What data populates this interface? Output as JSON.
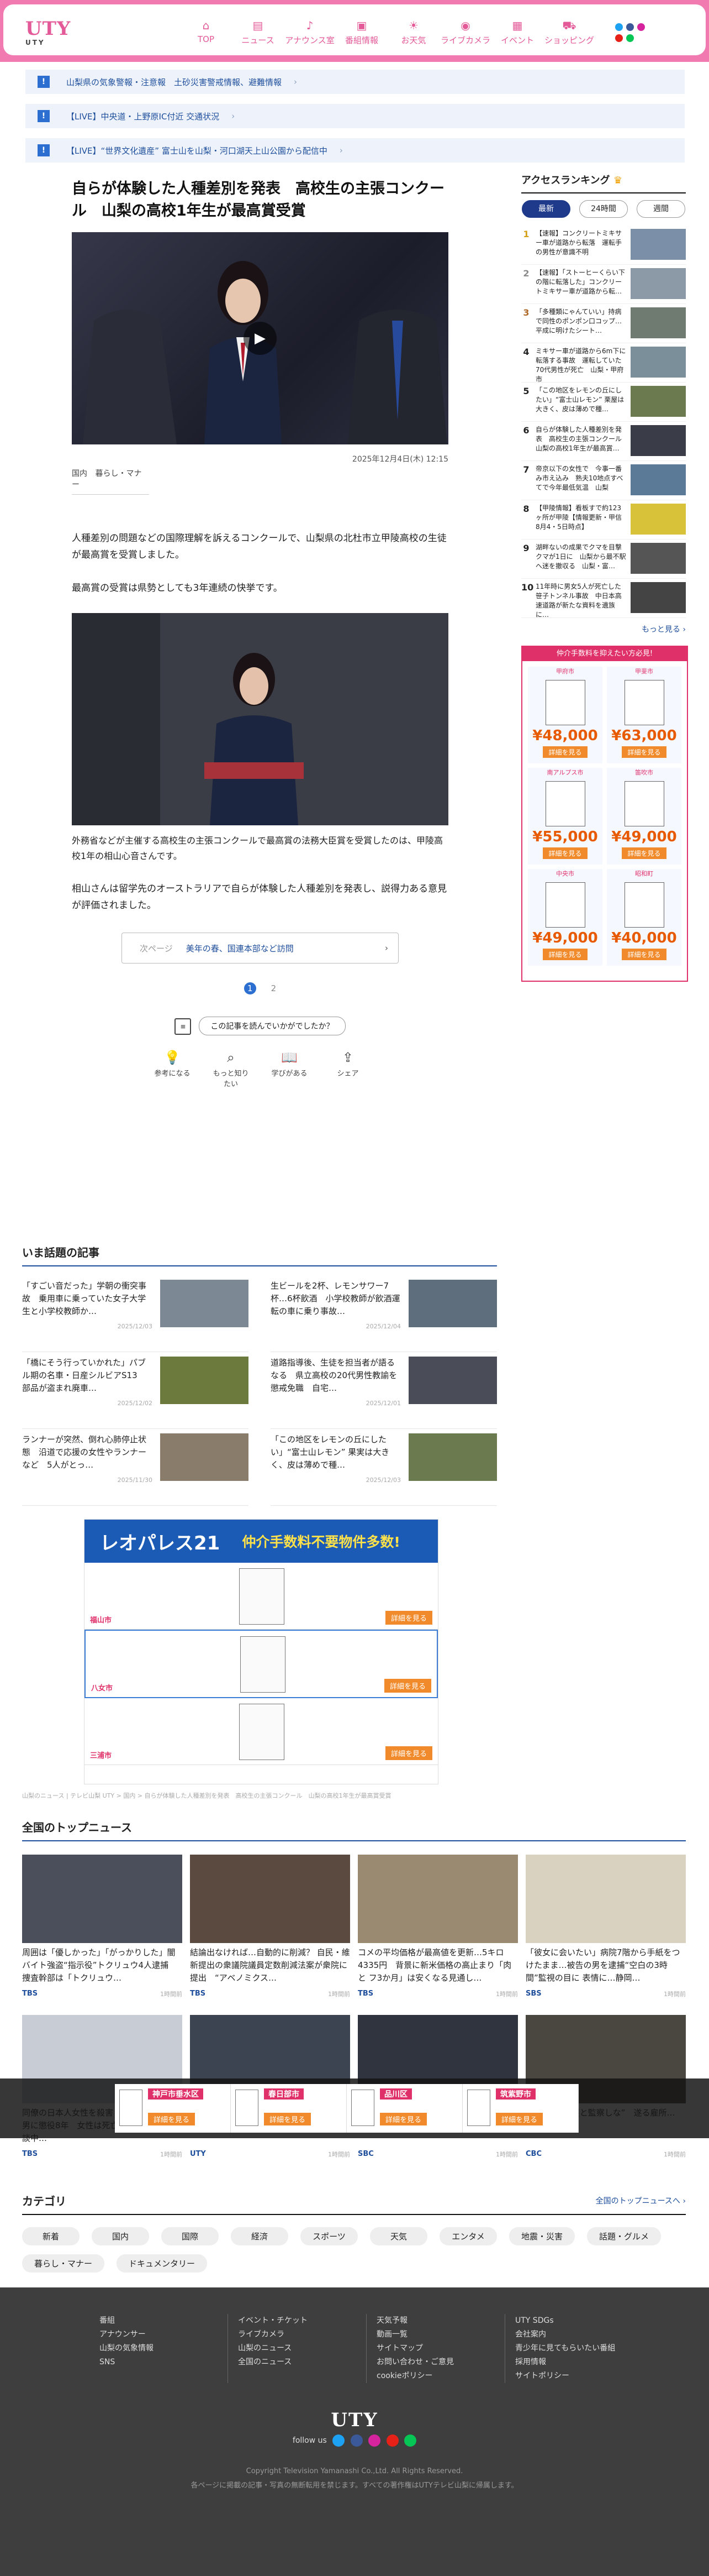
{
  "header": {
    "logo_main": "UTY",
    "logo_sub": "UTY",
    "nav": [
      {
        "label": "TOP",
        "icon": "home-icon",
        "glyph": "⌂"
      },
      {
        "label": "ニュース",
        "icon": "news-icon",
        "glyph": "▤"
      },
      {
        "label": "アナウンス室",
        "icon": "mic-icon",
        "glyph": "♪"
      },
      {
        "label": "番組情報",
        "icon": "tv-icon",
        "glyph": "▣"
      },
      {
        "label": "お天気",
        "icon": "weather-icon",
        "glyph": "☀"
      },
      {
        "label": "ライブカメラ",
        "icon": "camera-icon",
        "glyph": "◉"
      },
      {
        "label": "イベント",
        "icon": "calendar-icon",
        "glyph": "▦"
      },
      {
        "label": "ショッピング",
        "icon": "cart-icon",
        "glyph": "⛟"
      }
    ]
  },
  "alerts": [
    {
      "badge": "!",
      "text": "山梨県の気象警報・注意報　土砂災害警戒情報、避難情報"
    },
    {
      "badge": "!",
      "text": "【LIVE】中央道・上野原IC付近 交通状況"
    },
    {
      "badge": "!",
      "text": "【LIVE】“世界文化遺産” 富士山を山梨・河口湖天上山公園から配信中"
    }
  ],
  "article": {
    "title": "自らが体験した人種差別を発表　高校生の主張コンクール　山梨の高校1年生が最高賞受賞",
    "date": "2025年12月4日(木) 12:15",
    "categories": [
      "国内",
      "暮らし・マナー"
    ],
    "paragraphs": [
      "人種差別の問題などの国際理解を訴えるコンクールで、山梨県の北杜市立甲陵高校の生徒が最高賞を受賞しました。",
      "最高賞の受賞は県勢としても3年連続の快挙です。"
    ],
    "caption": "外務省などが主催する高校生の主張コンクールで最高賞の法務大臣賞を受賞したのは、甲陵高校1年の相山心音さんです。",
    "paragraph_last": "相山さんは留学先のオーストラリアで自らが体験した人種差別を発表し、説得力ある意見が評価されました。",
    "related_label": "次ページ",
    "related_text": "美年の春、国連本部など訪問",
    "pager_current": "1",
    "pager_other": "2",
    "reaction_question": "この記事を読んでいかがでしたか？",
    "reactions": [
      "参考になる",
      "もっと知りたい",
      "学びがある",
      "シェア"
    ]
  },
  "sidebar": {
    "ranking_title": "アクセスランキング",
    "tabs": [
      "最新",
      "24時間",
      "週間"
    ],
    "active_tab": "最新",
    "items": [
      {
        "no": "1",
        "text": "【速報】コンクリートミキサー車が道路から転落　運転手の男性が意識不明"
      },
      {
        "no": "2",
        "text": "【速報】「ストーヒーくらい下の階に転落した」コンクリートミキサー車が道路から転…"
      },
      {
        "no": "3",
        "text": "「多種類にゃんていい」持病で同性のポンポン口コップ…平成に明けたシート…"
      },
      {
        "no": "4",
        "text": "ミキサー車が道路から6m下に転落する事故　運転していた70代男性が死亡　山梨・甲府市"
      },
      {
        "no": "5",
        "text": "「この地区をレモンの丘にしたい」“富士山レモン” 栗屋は大きく、皮は薄めで種…"
      },
      {
        "no": "6",
        "text": "自らが体験した人種差別を発表　高校生の主張コンクール　山梨の高校1年生が最高賞…"
      },
      {
        "no": "7",
        "text": "帝京以下の女性で　今事一番み市え込み　熟夫10地点すべてで今年最低気温　山梨"
      },
      {
        "no": "8",
        "text": "【甲陵情報】看板すで約123ヶ所が甲陵【情報更新・甲信 8月4・5日時点】"
      },
      {
        "no": "9",
        "text": "湖畔ないの成果でクマを目撃　クマが1日に　山梨から最不駅へ迷を撤収る　山梨・富…"
      },
      {
        "no": "10",
        "text": "11年時に男女5人が死亡した笹子トンネル事故　中日本高速道路が新たな資料を遺族に…"
      }
    ],
    "more": "もっと見る",
    "ad_top": "仲介手数料を抑えたい方必見!",
    "ad_cells": [
      {
        "area": "甲府市",
        "price": "¥48,000",
        "btn": "詳細を見る"
      },
      {
        "area": "甲斐市",
        "price": "¥63,000",
        "btn": "詳細を見る"
      },
      {
        "area": "南アルプス市",
        "price": "¥55,000",
        "btn": "詳細を見る"
      },
      {
        "area": "笛吹市",
        "price": "¥49,000",
        "btn": "詳細を見る"
      },
      {
        "area": "中央市",
        "price": "¥49,000",
        "btn": "詳細を見る"
      },
      {
        "area": "昭和町",
        "price": "¥40,000",
        "btn": "詳細を見る"
      }
    ]
  },
  "topics": {
    "title": "いま話題の記事",
    "items": [
      {
        "text": "「すごい音だった」学朝の衝突事故　乗用車に乗っていた女子大学生と小学校教師か…",
        "date": "2025/12/03"
      },
      {
        "text": "生ビールを2杯、レモンサワー7杯…6杯飲酒　小学校教師が飲酒運転の車に乗り事故…",
        "date": "2025/12/04"
      },
      {
        "text": "「橋にそう行っていかれた」パブル期の名車・日産シルビアS13　部品が盗まれ廃車…",
        "date": "2025/12/02"
      },
      {
        "text": "道路指導後、生徒を担当者が語るなる　県立高校の20代男性教諭を懲戒免職　自宅…",
        "date": "2025/12/01"
      },
      {
        "text": "ランナーが突然、倒れ心肺停止状態　沿道で応援の女性やランナーなど　5人がとっ…",
        "date": "2025/11/30"
      },
      {
        "text": "「この地区をレモンの丘にしたい」“富士山レモン” 果実は大きく、皮は薄めで種…",
        "date": "2025/12/03"
      }
    ]
  },
  "mid_ad": {
    "brand": "レオパレス21",
    "headline": "仲介手数料不要物件多数!",
    "rows": [
      {
        "city": "福山市",
        "btn": "詳細を見る"
      },
      {
        "city": "八女市",
        "btn": "詳細を見る"
      },
      {
        "city": "三浦市",
        "btn": "詳細を見る"
      }
    ]
  },
  "breadcrumb": "山梨のニュース | テレビ山梨 UTY > 国内 > 自らが体験した人種差別を発表　高校生の主張コンクール　山梨の高校1年生が最高賞受賞",
  "national": {
    "title": "全国のトップニュース",
    "cards": [
      {
        "text": "周囲は「優しかった」「がっかりした」闇バイト強盗“指示役”トクリュウ4人逮捕　捜査幹部は「トクリュウ…",
        "src": "TBS",
        "date": "1時間前"
      },
      {
        "text": "結論出なければ…自動的に削減？ 自民・維新提出の衆議院議員定数削減法案が衆院に提出　“アベノミクス…",
        "src": "TBS",
        "date": "1時間前"
      },
      {
        "text": "コメの平均価格が最高値を更新…5キロ4335円　背景に新米価格の高止まり「肉と フ3か月」は安くなる見通し…",
        "src": "TBS",
        "date": "1時間前"
      },
      {
        "text": "「彼女に会いたい」病院7階から手紙をつけたまま…被告の男を逮捕“空白の3時間”監視の目に 表情に…静岡…",
        "src": "SBS",
        "date": "1時間前"
      },
      {
        "text": "同僚の日本人女性を殺害　ネパール国籍の男に懲役8年　女性は死亡…事件当時は面談中…",
        "src": "TBS",
        "date": "1時間前"
      },
      {
        "text": "山梨・甲州市の女性に懲役",
        "src": "UTY",
        "date": "1時間前"
      },
      {
        "text": "道交取なし　公園の喪主で",
        "src": "SBC",
        "date": "1時間前"
      },
      {
        "text": "は“被害者保護と監察しな”　遂る雇所…",
        "src": "CBC",
        "date": "1時間前"
      }
    ],
    "more": "全国のトップニュースへ",
    "float_ad": [
      "神戸市垂水区",
      "春日部市",
      "品川区",
      "筑紫野市"
    ],
    "float_btn": "詳細を見る"
  },
  "categories": {
    "title": "カテゴリ",
    "chips": [
      "新着",
      "国内",
      "国際",
      "経済",
      "スポーツ",
      "天気",
      "エンタメ",
      "地震・災害",
      "話題・グルメ",
      "暮らし・マナー",
      "ドキュメンタリー"
    ]
  },
  "footer": {
    "cols": [
      [
        "番組",
        "アナウンサー",
        "山梨の気象情報",
        "SNS"
      ],
      [
        "イベント・チケット",
        "ライブカメラ",
        "山梨のニュース",
        "全国のニュース"
      ],
      [
        "天気予報",
        "動画一覧",
        "サイトマップ",
        "お問い合わせ・ご意見",
        "cookieポリシー"
      ],
      [
        "UTY SDGs",
        "会社案内",
        "青少年に見てもらいたい番組",
        "採用情報",
        "サイトポリシー"
      ]
    ],
    "logo": "UTY",
    "follow": "follow us",
    "copyright": "Copyright Television Yamanashi Co.,Ltd. All Rights Reserved.",
    "notice": "各ページに掲載の記事・写真の無断転用を禁じます。すべての著作権はUTYテレビ山梨に帰属します。"
  },
  "colors": {
    "brand": "#f17ab0",
    "accent": "#2d6fd1",
    "nav_text": "#e45a98"
  }
}
